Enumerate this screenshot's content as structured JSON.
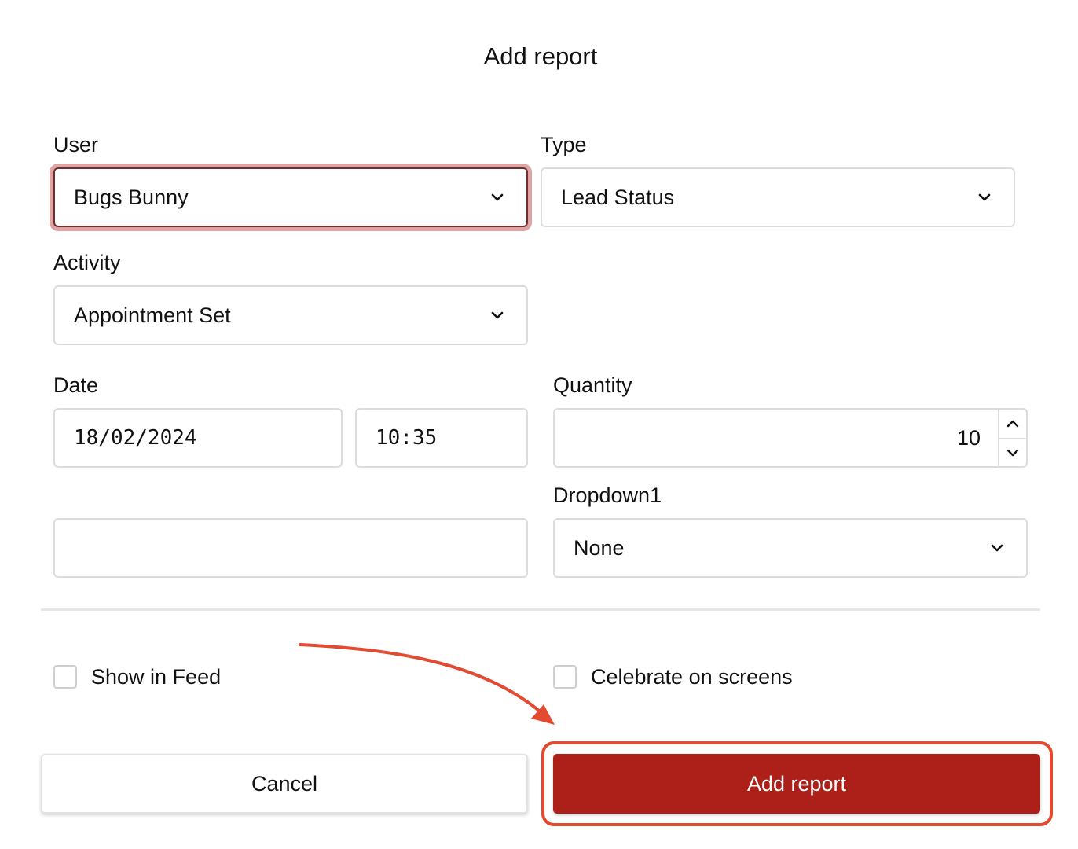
{
  "dialog": {
    "title": "Add report"
  },
  "fields": {
    "user": {
      "label": "User",
      "value": "Bugs Bunny"
    },
    "type": {
      "label": "Type",
      "value": "Lead Status"
    },
    "activity": {
      "label": "Activity",
      "value": "Appointment Set"
    },
    "date": {
      "label": "Date",
      "date_value": "18/02/2024",
      "time_value": "10:35"
    },
    "quantity": {
      "label": "Quantity",
      "value": "10"
    },
    "dropdown1": {
      "label": "Dropdown1",
      "value": "None"
    },
    "extra_input": {
      "value": ""
    }
  },
  "options": {
    "show_in_feed": {
      "label": "Show in Feed",
      "checked": false
    },
    "celebrate_on_screens": {
      "label": "Celebrate on screens",
      "checked": false
    }
  },
  "actions": {
    "cancel_label": "Cancel",
    "add_label": "Add report"
  },
  "colors": {
    "primary": "#ac2019",
    "annotation": "#e24a32",
    "focus_ring": "#dfa3a3"
  },
  "icons": {
    "select_chevron": "chevron-down-icon",
    "spin_up": "chevron-up-icon",
    "spin_down": "chevron-down-icon",
    "annotation": "arrow-annotation-icon"
  }
}
